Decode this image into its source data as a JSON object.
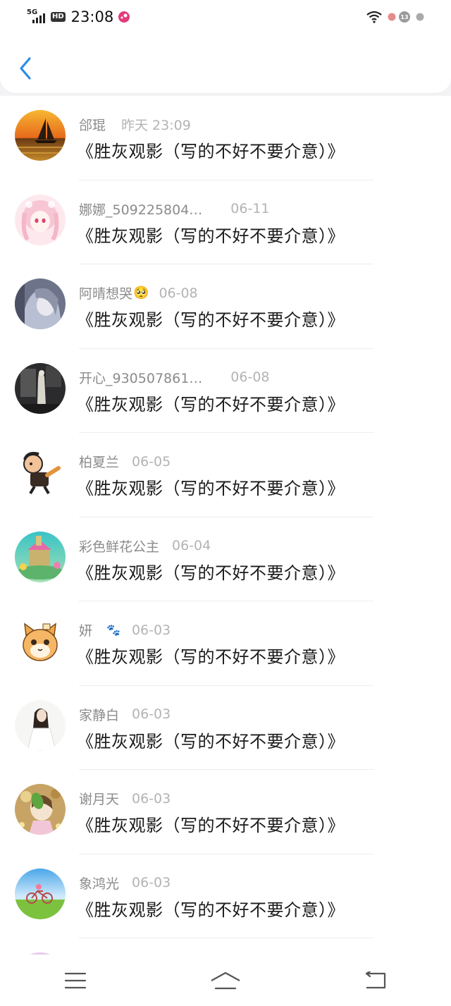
{
  "status_bar": {
    "network": "5G",
    "hd": "HD",
    "time": "23:08",
    "notification_count": "13"
  },
  "colors": {
    "accent": "#2a8de6"
  },
  "items": [
    {
      "name": "郃琨",
      "time": "昨天 23:09",
      "title": "《胜灰观影（写的不好不要介意）》",
      "avatar": "sunset-sail"
    },
    {
      "name": "娜娜_509225804…",
      "time": "06-11",
      "title": "《胜灰观影（写的不好不要介意）》",
      "avatar": "pink-anime"
    },
    {
      "name": "阿晴想哭",
      "time": "06-08",
      "title": "《胜灰观影（写的不好不要介意）》",
      "avatar": "grey-anime",
      "emoji": "🥺"
    },
    {
      "name": "开心_930507861…",
      "time": "06-08",
      "title": "《胜灰观影（写的不好不要介意）》",
      "avatar": "dark-figure"
    },
    {
      "name": "柏夏兰",
      "time": "06-05",
      "title": "《胜灰观影（写的不好不要介意）》",
      "avatar": "cartoon-fighter"
    },
    {
      "name": "彩色鲜花公主",
      "time": "06-04",
      "title": "《胜灰观影（写的不好不要介意）》",
      "avatar": "castle"
    },
    {
      "name": "妍",
      "time": "06-03",
      "title": "《胜灰观影（写的不好不要介意）》",
      "avatar": "orange-cat",
      "emoji": "🐾"
    },
    {
      "name": "家静白",
      "time": "06-03",
      "title": "《胜灰观影（写的不好不要介意）》",
      "avatar": "girl-white"
    },
    {
      "name": "谢月天",
      "time": "06-03",
      "title": "《胜灰观影（写的不好不要介意）》",
      "avatar": "leaf-girl"
    },
    {
      "name": "象鸿光",
      "time": "06-03",
      "title": "《胜灰观影（写的不好不要介意）》",
      "avatar": "bicycle-field"
    }
  ],
  "nav": [
    "menu-icon",
    "home-icon",
    "back-icon"
  ]
}
